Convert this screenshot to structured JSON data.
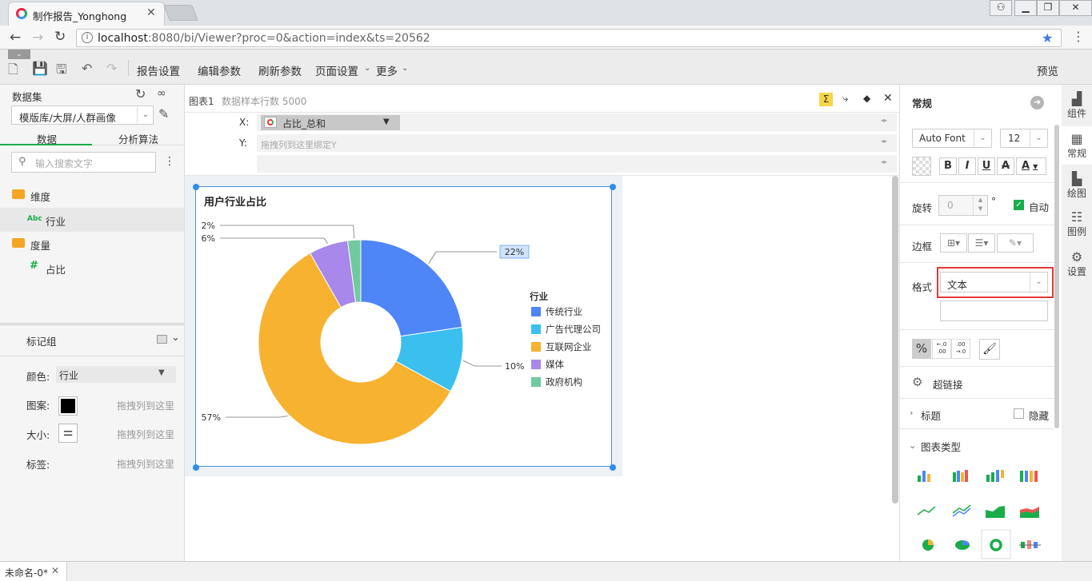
{
  "browser": {
    "tab_title": "制作报告_Yonghong",
    "url_host": "localhost",
    "url_rest": ":8080/bi/Viewer?proc=0&action=index&ts=20562"
  },
  "toolbar": {
    "report_settings": "报告设置",
    "edit_params": "编辑参数",
    "refresh_params": "刷新参数",
    "page_settings": "页面设置",
    "more": "更多",
    "preview": "预览"
  },
  "left": {
    "dataset_label": "数据集",
    "dataset_value": "模版库/大屏/人群画像",
    "tab_data": "数据",
    "tab_algo": "分析算法",
    "search_placeholder": "输入搜索文字",
    "dimension_label": "维度",
    "dimension_item": "行业",
    "dimension_item_badge": "Abc",
    "measure_label": "度量",
    "measure_item": "占比",
    "marks_label": "标记组",
    "color_label": "颜色:",
    "color_value": "行业",
    "shape_label": "图案:",
    "size_label": "大小:",
    "tag_label": "标签:",
    "drop_hint": "拖拽列到这里"
  },
  "center": {
    "chart_name": "图表1",
    "sample_rows": "数据样本行数 5000",
    "x_label": "X:",
    "x_value": "占比_总和",
    "y_label": "Y:",
    "y_placeholder": "拖拽列到这里绑定Y"
  },
  "chart_data": {
    "type": "pie",
    "donut": true,
    "title": "用户行业占比",
    "legend_title": "行业",
    "legend_position": "right",
    "slices": [
      {
        "name": "传统行业",
        "value": 22,
        "label": "22%",
        "color": "#4e86f7"
      },
      {
        "name": "广告代理公司",
        "value": 10,
        "label": "10%",
        "color": "#3bbfee"
      },
      {
        "name": "互联网企业",
        "value": 57,
        "label": "57%",
        "color": "#f7b22f"
      },
      {
        "name": "媒体",
        "value": 6,
        "label": "6%",
        "color": "#a888ea"
      },
      {
        "name": "政府机构",
        "value": 2,
        "label": "2%",
        "color": "#72c9a0"
      }
    ]
  },
  "right": {
    "section_title": "常规",
    "font_name": "Auto Font",
    "font_size": "12",
    "rotate_label": "旋转",
    "rotate_value": "0",
    "degree_symbol": "°",
    "auto_label": "自动",
    "border_label": "边框",
    "format_label": "格式",
    "format_value": "文本",
    "hyperlink_label": "超链接",
    "title_label": "标题",
    "hide_label": "隐藏",
    "chart_type_label": "图表类型"
  },
  "sidetabs": [
    "组件",
    "常规",
    "绘图",
    "图例",
    "设置"
  ],
  "bottom": {
    "tab_label": "未命名-0*"
  },
  "colors": {
    "accent": "#1aac4a",
    "selection": "#4a90e2",
    "highlight_box": "#e53935"
  }
}
